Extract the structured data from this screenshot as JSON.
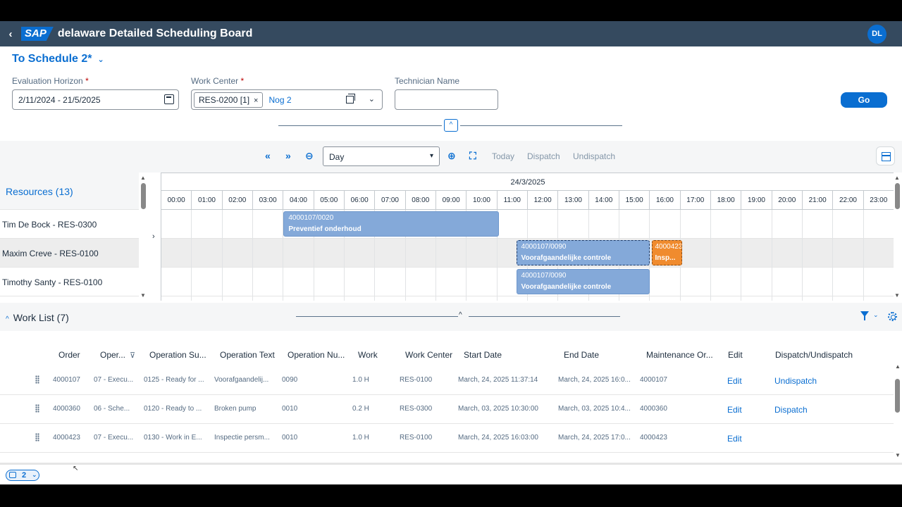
{
  "shell": {
    "back": "‹",
    "logo": "SAP",
    "title": "delaware Detailed Scheduling Board",
    "avatar": "DL"
  },
  "variant": {
    "title": "To Schedule 2*",
    "chevron": "⌄"
  },
  "filters": {
    "horizon": {
      "label": "Evaluation Horizon",
      "required": "*",
      "value": "2/11/2024 - 21/5/2025"
    },
    "work_center": {
      "label": "Work Center",
      "required": "*",
      "token": "RES-0200 [1]",
      "token_remove": "×",
      "more": "Nog 2"
    },
    "technician": {
      "label": "Technician Name",
      "value": ""
    },
    "go": "Go",
    "collapse": "^"
  },
  "gantt_toolbar": {
    "prev": "«",
    "next": "»",
    "zoom_out": "⊖",
    "view": "Day",
    "view_arrow": "▾",
    "zoom_in": "⊕",
    "fit": "⛶",
    "today": "Today",
    "dispatch": "Dispatch",
    "undispatch": "Undispatch"
  },
  "resources": {
    "header": "Resources (13)",
    "items": [
      "Tim De Bock - RES-0300",
      "Maxim Creve - RES-0100",
      "Timothy Santy - RES-0100"
    ],
    "expand": "›"
  },
  "chart": {
    "date": "24/3/2025",
    "hours": [
      "00:00",
      "01:00",
      "02:00",
      "03:00",
      "04:00",
      "05:00",
      "06:00",
      "07:00",
      "08:00",
      "09:00",
      "10:00",
      "11:00",
      "12:00",
      "13:00",
      "14:00",
      "15:00",
      "16:00",
      "17:00",
      "18:00",
      "19:00",
      "20:00",
      "21:00",
      "22:00",
      "23:00"
    ],
    "bars": [
      {
        "row": 0,
        "start": 4.0,
        "end": 11.05,
        "order": "4000107/0020",
        "text": "Preventief onderhoud",
        "color": "blue",
        "selected": false
      },
      {
        "row": 1,
        "start": 11.62,
        "end": 16.0,
        "order": "4000107/0090",
        "text": "Voorafgaandelijke controle",
        "color": "blue",
        "selected": true
      },
      {
        "row": 1,
        "start": 16.05,
        "end": 17.05,
        "order": "4000423",
        "text": "Insp...",
        "color": "orange",
        "selected": true
      },
      {
        "row": 2,
        "start": 11.62,
        "end": 16.0,
        "order": "4000107/0090",
        "text": "Voorafgaandelijke controle",
        "color": "blue",
        "selected": false
      }
    ]
  },
  "worklist": {
    "title": "Work List (7)",
    "caret": "^",
    "collapse": "^",
    "filter_caret": "⌄",
    "columns": [
      "Order",
      "Oper...",
      "Operation Su...",
      "Operation Text",
      "Operation Nu...",
      "Work",
      "Work Center",
      "Start Date",
      "End Date",
      "Maintenance Or...",
      "Edit",
      "Dispatch/Undispatch"
    ],
    "sort_glyph": "⊽",
    "rows": [
      {
        "order": "4000107",
        "oper": "07 - Execu...",
        "status": "0125 - Ready for ...",
        "text": "Voorafgaandelij...",
        "num": "0090",
        "work": "1.0 H",
        "wc": "RES-0100",
        "start": "March, 24, 2025 11:37:14",
        "end": "March, 24, 2025 16:0...",
        "maint": "4000107",
        "edit": "Edit",
        "dispatch": "Undispatch"
      },
      {
        "order": "4000360",
        "oper": "06 - Sche...",
        "status": "0120 - Ready to ...",
        "text": "Broken pump",
        "num": "0010",
        "work": "0.2 H",
        "wc": "RES-0300",
        "start": "March, 03, 2025 10:30:00",
        "end": "March, 03, 2025 10:4...",
        "maint": "4000360",
        "edit": "Edit",
        "dispatch": "Dispatch"
      },
      {
        "order": "4000423",
        "oper": "07 - Execu...",
        "status": "0130 - Work in E...",
        "text": "Inspectie persm...",
        "num": "0010",
        "work": "1.0 H",
        "wc": "RES-0100",
        "start": "March, 24, 2025 16:03:00",
        "end": "March, 24, 2025 17:0...",
        "maint": "4000423",
        "edit": "Edit",
        "dispatch": ""
      }
    ]
  },
  "footer": {
    "messages": "2",
    "caret": "⌄"
  },
  "colors": {
    "shell": "#354a5f",
    "brand": "#0a6ed1",
    "bar_blue": "#84a9d9",
    "bar_orange": "#f08b2e"
  }
}
